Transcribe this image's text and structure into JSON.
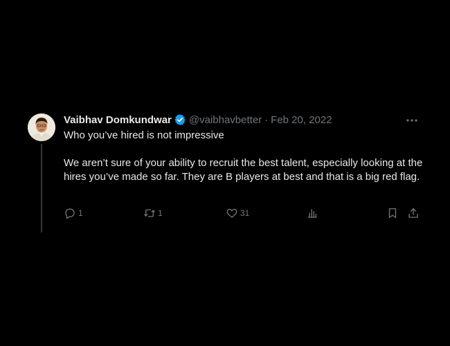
{
  "tweet": {
    "author_name": "Vaibhav Domkundwar",
    "handle": "@vaibhavbetter",
    "separator": "·",
    "date": "Feb 20, 2022",
    "paragraphs": [
      "Who you’ve hired is not impressive",
      "We aren’t sure of your ability to recruit the best talent, especially looking at the hires you’ve made so far. They are B players at best and that is a big red flag."
    ],
    "replies": "1",
    "retweets": "1",
    "likes": "31",
    "verified": true
  },
  "icons": {
    "verified": "verified-badge-icon",
    "more": "more-options-icon",
    "reply": "reply-icon",
    "retweet": "retweet-icon",
    "like": "like-icon",
    "views": "views-icon",
    "bookmark": "bookmark-icon",
    "share": "share-icon"
  },
  "colors": {
    "background": "#000000",
    "text_primary": "#e7e9ea",
    "text_secondary": "#71767b",
    "verified_blue": "#1d9bf0",
    "thread_line": "#333639"
  }
}
